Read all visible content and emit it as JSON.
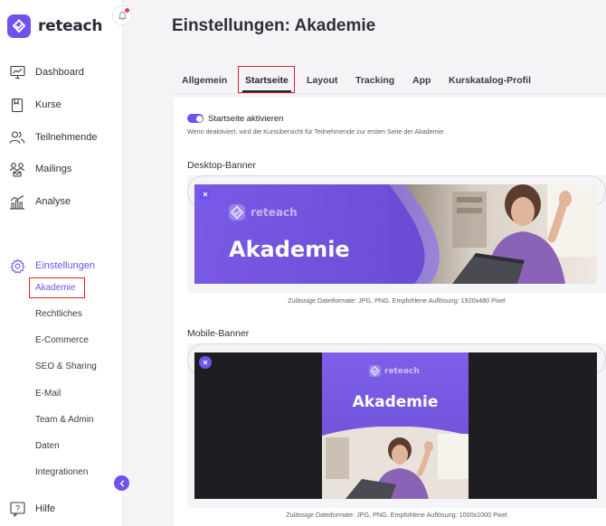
{
  "app": {
    "brand": "reteach",
    "page_title": "Einstellungen: Akademie"
  },
  "sidebar": {
    "items": [
      {
        "id": "dashboard",
        "label": "Dashboard",
        "icon": "dashboard-icon"
      },
      {
        "id": "kurse",
        "label": "Kurse",
        "icon": "course-book-icon"
      },
      {
        "id": "teilnehmende",
        "label": "Teilnehmende",
        "icon": "users-icon"
      },
      {
        "id": "mailings",
        "label": "Mailings",
        "icon": "mailings-people-icon"
      },
      {
        "id": "analyse",
        "label": "Analyse",
        "icon": "analytics-chart-icon"
      },
      {
        "id": "einstellungen",
        "label": "Einstellungen",
        "icon": "gear-icon",
        "active": true
      }
    ],
    "sub_items": [
      {
        "label": "Akademie",
        "active": true
      },
      {
        "label": "Rechtliches"
      },
      {
        "label": "E-Commerce"
      },
      {
        "label": "SEO & Sharing"
      },
      {
        "label": "E-Mail"
      },
      {
        "label": "Team & Admin"
      },
      {
        "label": "Daten"
      },
      {
        "label": "Integrationen"
      }
    ],
    "help": {
      "label": "Hilfe",
      "icon": "help-icon"
    }
  },
  "tabs": [
    {
      "label": "Allgemein"
    },
    {
      "label": "Startseite",
      "active": true
    },
    {
      "label": "Layout"
    },
    {
      "label": "Tracking"
    },
    {
      "label": "App"
    },
    {
      "label": "Kurskatalog-Profil"
    }
  ],
  "startpage": {
    "toggle_label": "Startseite aktivieren",
    "toggle_on": true,
    "toggle_hint": "Wenn deaktiviert, wird die Kursübersicht für Teilnehmende zur ersten Seite der Akademie."
  },
  "desktop_banner": {
    "title": "Desktop-Banner",
    "banner_brand": "reteach",
    "banner_headline": "Akademie",
    "hint": "Zulässige Dateiformate: JPG, PNG. Empfohlene Auflösung: 1920x480 Pixel"
  },
  "mobile_banner": {
    "title": "Mobile-Banner",
    "banner_brand": "reteach",
    "banner_headline": "Akademie",
    "hint": "Zulässige Dateiformate: JPG, PNG. Empfohlene Auflösung: 1000x1000 Pixel"
  },
  "colors": {
    "accent": "#6f52ed",
    "highlight_box": "#d9232e",
    "banner_purple": "#6e4fd6"
  }
}
